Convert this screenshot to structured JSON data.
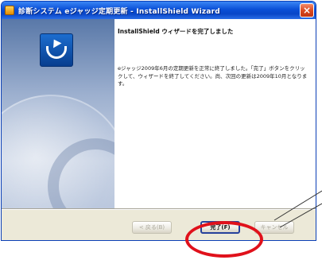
{
  "window": {
    "title": "診断システム eジャッジ定期更新 - InstallShield Wizard",
    "close_glyph": "×"
  },
  "content": {
    "heading": "InstallShield ウィザードを完了しました",
    "body": "eジャッジ2009年6月の定期更新を正常に終了しました。「完了」ボタンをクリックして、ウィザードを終了してください。尚、次回の更新は2009年10月となります。"
  },
  "buttons": {
    "back": "< 戻る(B)",
    "finish": "完了(F)",
    "cancel": "キャンセル"
  },
  "annotation": {
    "highlight_color": "#e0111b"
  }
}
